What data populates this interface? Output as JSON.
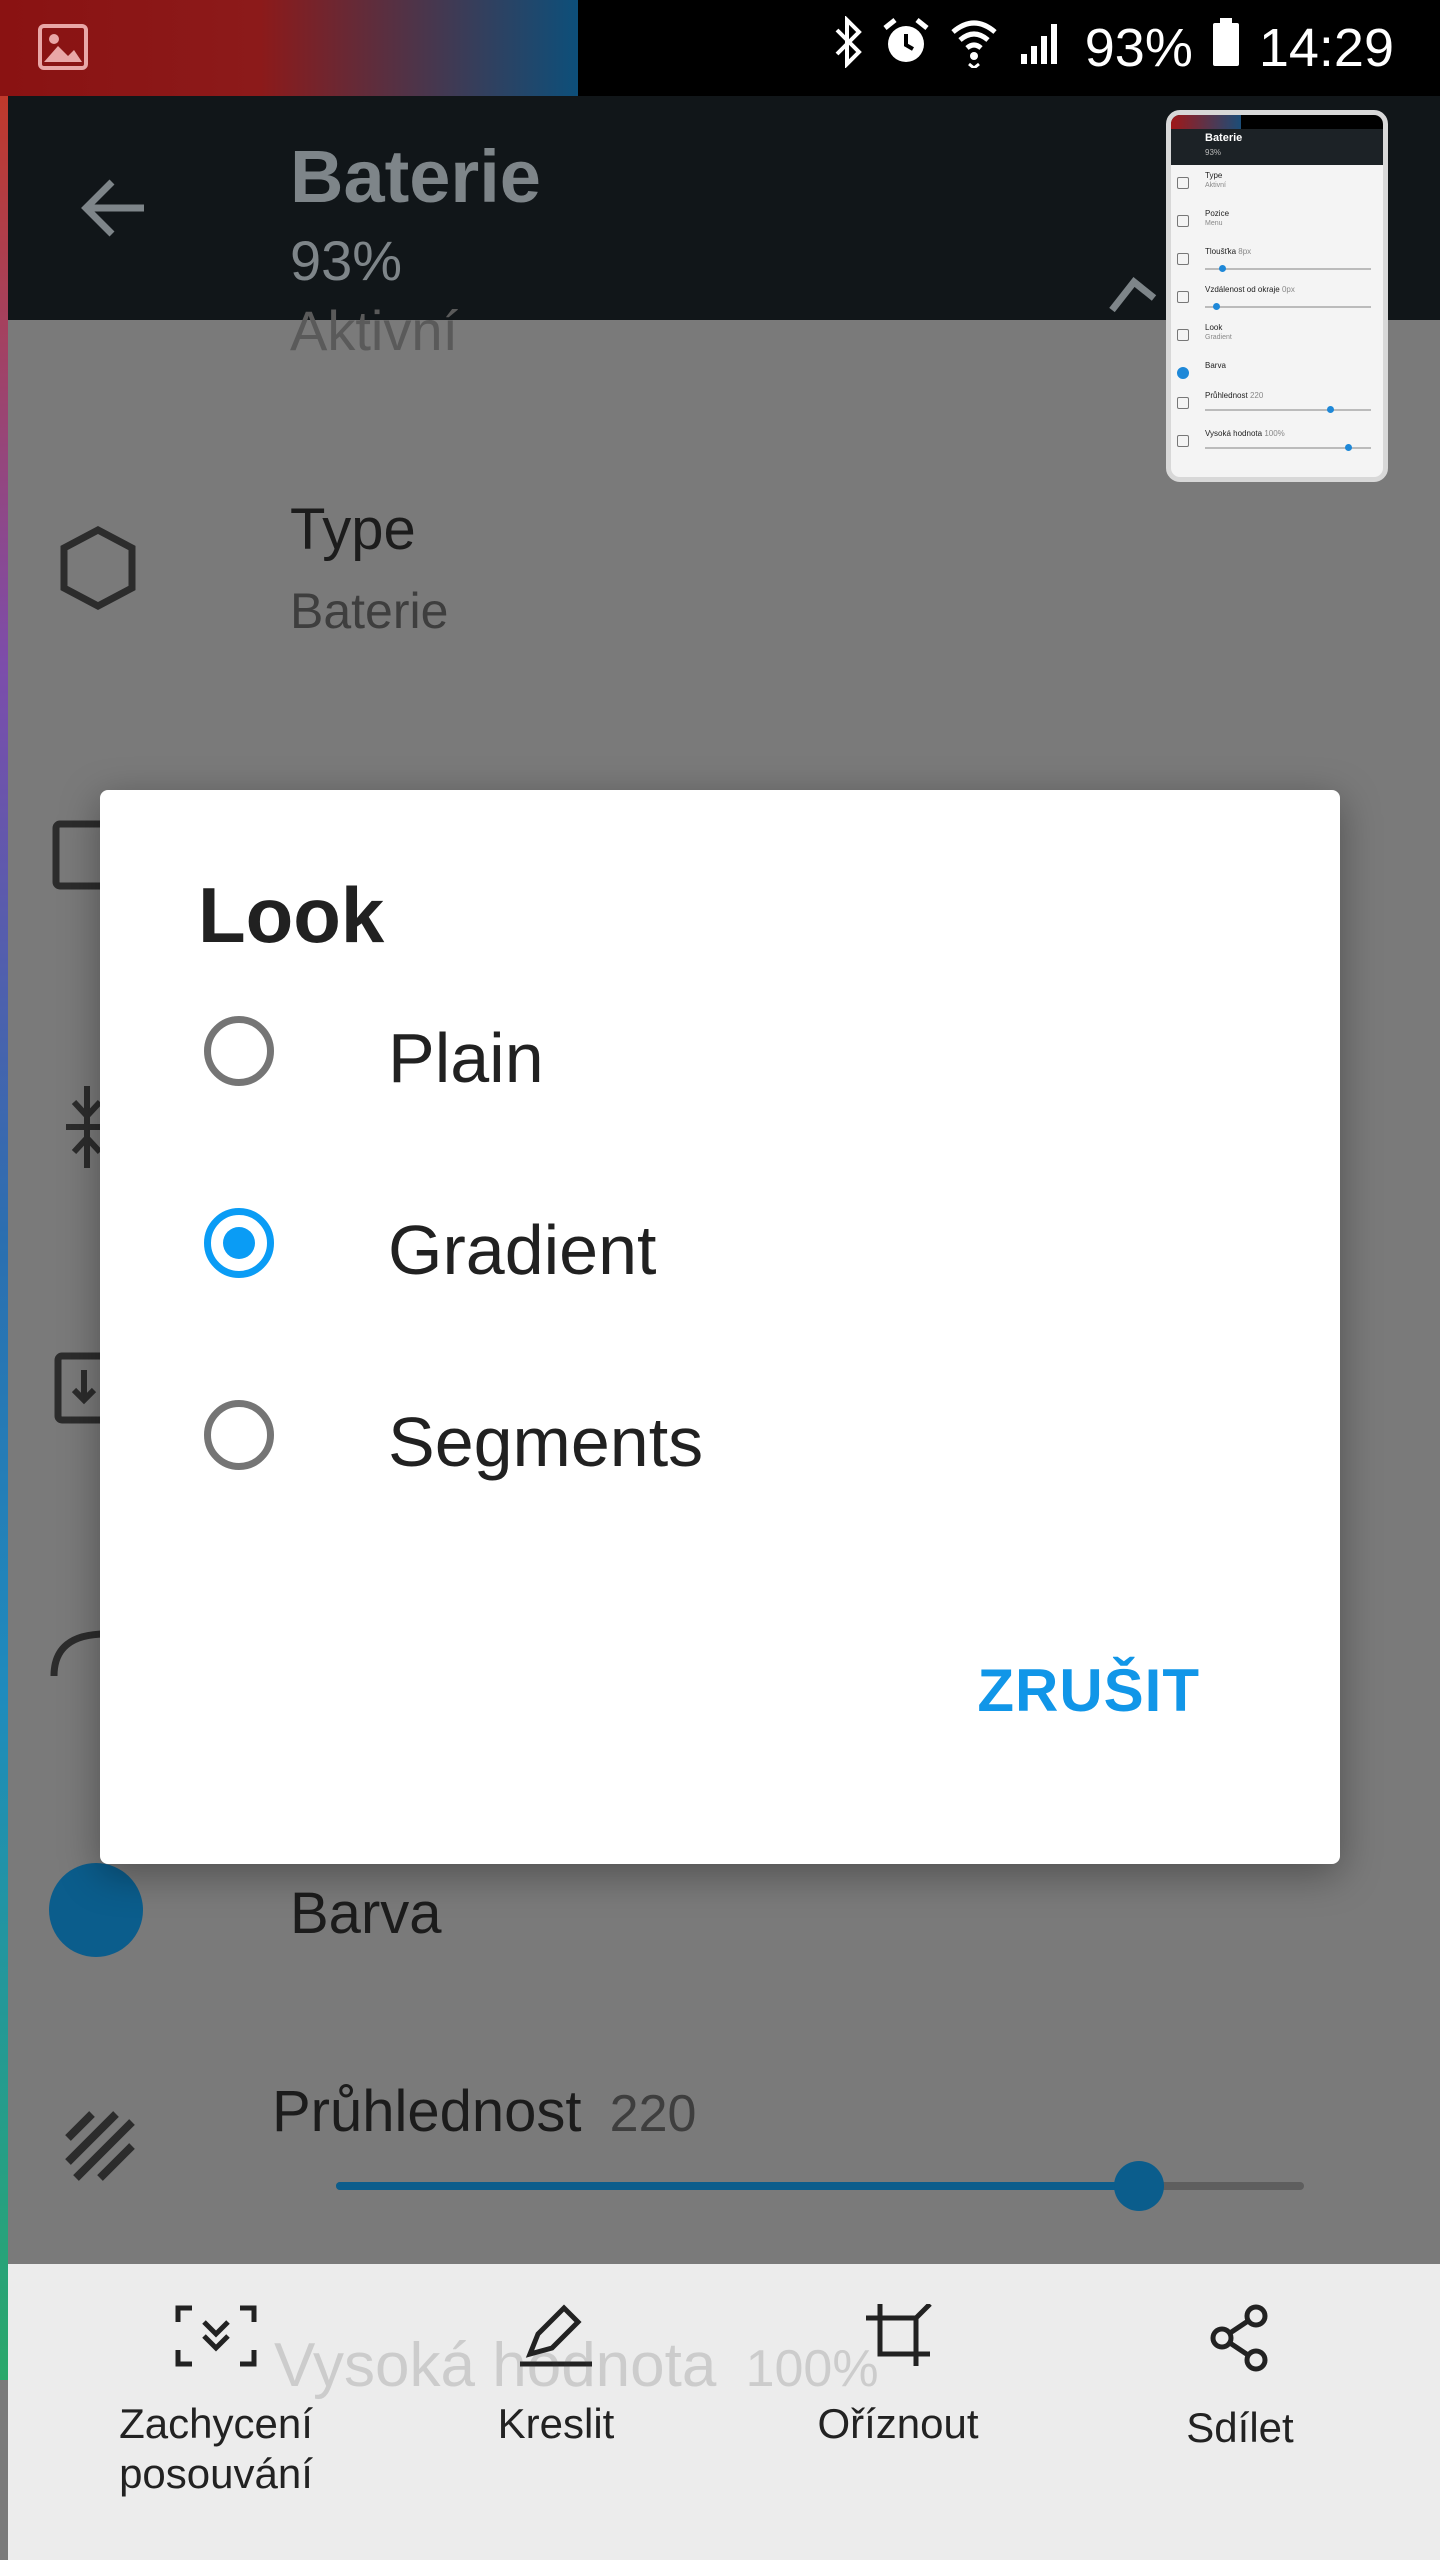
{
  "status_bar": {
    "battery": "93%",
    "time": "14:29"
  },
  "app_bar": {
    "title": "Baterie",
    "subtitle": "93%"
  },
  "background_list": {
    "partial_item": "Aktivní",
    "type_item": {
      "title": "Type",
      "value": "Baterie"
    },
    "barva_item": {
      "title": "Barva"
    },
    "pruhlednost": {
      "label": "Průhlednost",
      "value": "220",
      "fraction": 0.83
    },
    "vysoka_hodnota": {
      "label": "Vysoká hodnota",
      "value": "100%",
      "fraction": 1.0
    },
    "accent_color": "#0b5d8c"
  },
  "preview_thumbnail": {
    "title": "Baterie",
    "subtitle": "93%",
    "rows": [
      {
        "title": "Type",
        "sub": "Aktivní"
      },
      {
        "title": "Pozice",
        "sub": "Menu"
      },
      {
        "title": "Tloušťka",
        "sub": "8px"
      },
      {
        "title": "Vzdálenost od okraje",
        "sub": "0px"
      },
      {
        "title": "Look",
        "sub": "Gradient"
      },
      {
        "title": "Barva",
        "sub": ""
      },
      {
        "title": "Průhlednost",
        "sub": "220"
      },
      {
        "title": "Vysoká hodnota",
        "sub": "100%"
      }
    ]
  },
  "dialog": {
    "title": "Look",
    "options": [
      {
        "label": "Plain",
        "selected": false
      },
      {
        "label": "Gradient",
        "selected": true
      },
      {
        "label": "Segments",
        "selected": false
      }
    ],
    "cancel_label": "ZRUŠIT",
    "accent_color": "#0a9cf5"
  },
  "bottom_bar": {
    "items": [
      {
        "label": "Zachycení posouvání",
        "icon": "scroll-capture-icon"
      },
      {
        "label": "Kreslit",
        "icon": "draw-icon"
      },
      {
        "label": "Oříznout",
        "icon": "crop-icon"
      },
      {
        "label": "Sdílet",
        "icon": "share-icon"
      }
    ]
  }
}
